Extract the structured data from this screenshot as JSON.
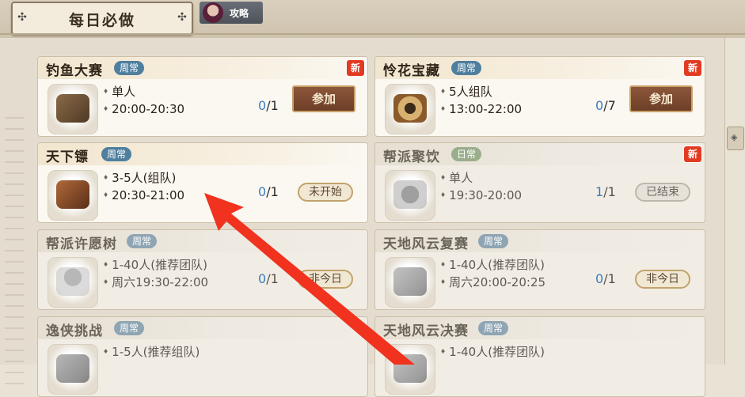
{
  "header": {
    "title": "每日必做",
    "guide_label": "攻略"
  },
  "cards": [
    {
      "name": "钓鱼大赛",
      "tag": "周常",
      "new": "新",
      "players": "单人",
      "time": "20:00-20:30",
      "progress_cur": "0",
      "progress_total": "/1",
      "action": "参加"
    },
    {
      "name": "怜花宝藏",
      "tag": "周常",
      "new": "新",
      "players": "5人组队",
      "time": "13:00-22:00",
      "progress_cur": "0",
      "progress_total": "/7",
      "action": "参加"
    },
    {
      "name": "天下镖",
      "tag": "周常",
      "players": "3-5人(组队)",
      "time": "20:30-21:00",
      "progress_cur": "0",
      "progress_total": "/1",
      "action": "未开始"
    },
    {
      "name": "帮派聚饮",
      "tag": "日常",
      "new": "新",
      "players": "单人",
      "time": "19:30-20:00",
      "progress_cur": "1",
      "progress_total": "/1",
      "action": "已结束"
    },
    {
      "name": "帮派许愿树",
      "tag": "周常",
      "players": "1-40人(推荐团队)",
      "time": "周六19:30-22:00",
      "progress_cur": "0",
      "progress_total": "/1",
      "action": "非今日"
    },
    {
      "name": "天地风云复赛",
      "tag": "周常",
      "players": "1-40人(推荐团队)",
      "time": "周六20:00-20:25",
      "progress_cur": "0",
      "progress_total": "/1",
      "action": "非今日"
    },
    {
      "name": "逸侠挑战",
      "tag": "周常",
      "players": "1-5人(推荐组队)",
      "time": "",
      "progress_cur": "",
      "progress_total": "",
      "action": ""
    },
    {
      "name": "天地风云决赛",
      "tag": "周常",
      "players": "1-40人(推荐团队)",
      "time": "",
      "progress_cur": "",
      "progress_total": "",
      "action": ""
    }
  ],
  "colors": {
    "arrow": "#f0321e",
    "join_button": "#7a4a30",
    "tag_weekly": "#4f7f9e",
    "tag_daily": "#7a9a63",
    "new_badge": "#e23b22",
    "progress_current": "#3c7cc0"
  },
  "icons": {
    "title_ornament": "knot-ornament-icon",
    "side_handle": "ornament-knob-icon",
    "arrow": "red-pointer-arrow"
  }
}
